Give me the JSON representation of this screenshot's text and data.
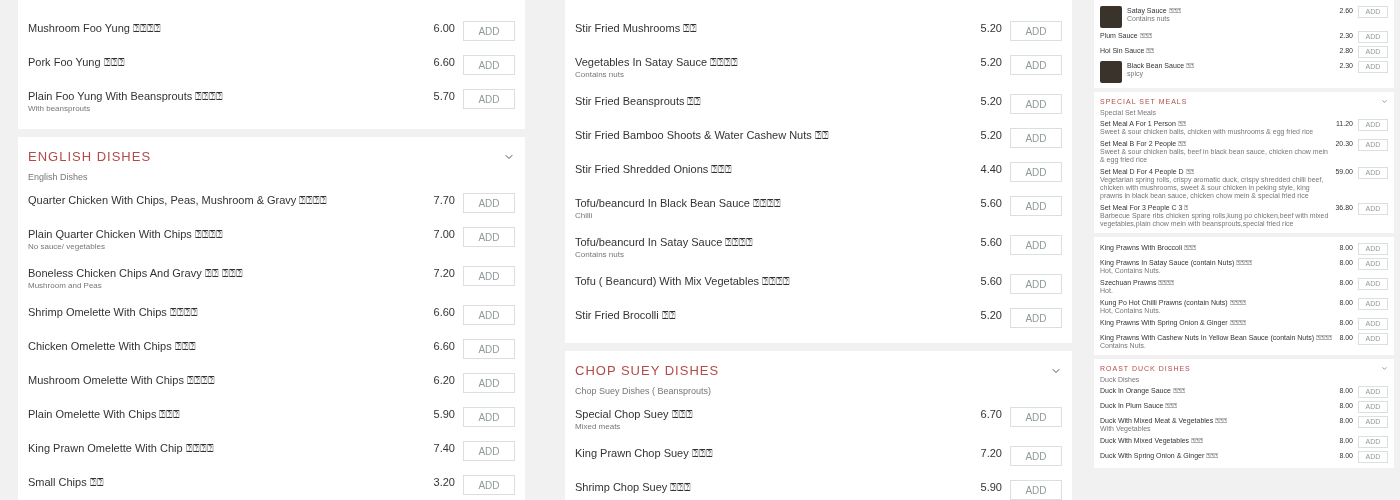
{
  "columns": [
    {
      "cards": [
        {
          "items": [
            {
              "name": "Mushroom Foo Yung ⍰⍰⍰⍰",
              "price": "6.00",
              "button": "ADD"
            },
            {
              "name": "Pork Foo Yung ⍰⍰⍰",
              "price": "6.60",
              "button": "ADD"
            },
            {
              "name": "Plain Foo Yung With Beansprouts ⍰⍰⍰⍰",
              "description": "With beansprouts",
              "price": "5.70",
              "button": "ADD"
            }
          ]
        },
        {
          "title": "ENGLISH DISHES",
          "subtitle": "English Dishes",
          "items": [
            {
              "name": "Quarter Chicken With Chips, Peas, Mushroom & Gravy ⍰⍰⍰⍰",
              "price": "7.70",
              "button": "ADD"
            },
            {
              "name": "Plain Quarter Chicken With Chips ⍰⍰⍰⍰",
              "description": "No sauce/ vegetables",
              "price": "7.00",
              "button": "ADD"
            },
            {
              "name": "Boneless Chicken Chips And Gravy ⍰⍰ ⍰⍰⍰",
              "description": "Mushroom and Peas",
              "price": "7.20",
              "button": "ADD"
            },
            {
              "name": "Shrimp Omelette With Chips ⍰⍰⍰⍰",
              "price": "6.60",
              "button": "ADD"
            },
            {
              "name": "Chicken Omelette With Chips ⍰⍰⍰",
              "price": "6.60",
              "button": "ADD"
            },
            {
              "name": "Mushroom Omelette With Chips ⍰⍰⍰⍰",
              "price": "6.20",
              "button": "ADD"
            },
            {
              "name": "Plain Omelette With Chips ⍰⍰⍰",
              "price": "5.90",
              "button": "ADD"
            },
            {
              "name": "King Prawn Omelette With Chip ⍰⍰⍰⍰",
              "price": "7.40",
              "button": "ADD"
            },
            {
              "name": "Small Chips ⍰⍰",
              "price": "3.20",
              "button": "ADD"
            }
          ]
        }
      ]
    },
    {
      "cards": [
        {
          "items": [
            {
              "name": "Stir Fried Mushrooms ⍰⍰",
              "price": "5.20",
              "button": "ADD"
            },
            {
              "name": "Vegetables In Satay Sauce ⍰⍰⍰⍰",
              "description": "Contains nuts",
              "price": "5.20",
              "button": "ADD"
            },
            {
              "name": "Stir Fried Beansprouts ⍰⍰",
              "price": "5.20",
              "button": "ADD"
            },
            {
              "name": "Stir Fried Bamboo Shoots & Water Cashew Nuts ⍰⍰",
              "price": "5.20",
              "button": "ADD"
            },
            {
              "name": "Stir Fried Shredded Onions ⍰⍰⍰",
              "price": "4.40",
              "button": "ADD"
            },
            {
              "name": "Tofu/beancurd In Black Bean Sauce ⍰⍰⍰⍰",
              "description": "Chilli",
              "price": "5.60",
              "button": "ADD"
            },
            {
              "name": "Tofu/beancurd In Satay Sauce ⍰⍰⍰⍰",
              "description": "Contains nuts",
              "price": "5.60",
              "button": "ADD"
            },
            {
              "name": "Tofu ( Beancurd) With Mix Vegetables ⍰⍰⍰⍰",
              "price": "5.60",
              "button": "ADD"
            },
            {
              "name": "Stir Fried Brocolli ⍰⍰",
              "price": "5.20",
              "button": "ADD"
            }
          ]
        },
        {
          "title": "CHOP SUEY DISHES",
          "subtitle": "Chop Suey Dishes ( Beansprouts)",
          "items": [
            {
              "name": "Special Chop Suey ⍰⍰⍰",
              "description": "Mixed meats",
              "price": "6.70",
              "button": "ADD"
            },
            {
              "name": "King Prawn Chop Suey ⍰⍰⍰",
              "price": "7.20",
              "button": "ADD"
            },
            {
              "name": "Shrimp Chop Suey ⍰⍰⍰",
              "price": "5.90",
              "button": "ADD"
            }
          ]
        }
      ]
    },
    {
      "cards": [
        {
          "items": [
            {
              "name": "Satay Sauce ⍰⍰⍰",
              "description": "Contains nuts",
              "price": "2.60",
              "button": "ADD",
              "photo": true
            },
            {
              "name": "Plum Sauce ⍰⍰⍰",
              "price": "2.30",
              "button": "ADD"
            },
            {
              "name": "Hoi Sin Sauce ⍰⍰",
              "price": "2.80",
              "button": "ADD"
            },
            {
              "name": "Black Bean Sauce ⍰⍰",
              "description": "spicy",
              "price": "2.30",
              "button": "ADD",
              "photo": true
            }
          ]
        },
        {
          "title": "SPECIAL SET MEALS",
          "subtitle": "Special Set Meals",
          "items": [
            {
              "name": "Set Meal A For 1 Person ⍰⍰",
              "description": "Sweet & sour chicken balls, chicken with mushrooms & egg fried rice",
              "price": "11.20",
              "button": "ADD"
            },
            {
              "name": "Set Meal B For 2 People ⍰⍰",
              "description": "Sweet & sour chicken balls, beef in black bean sauce, chicken chow mein & egg fried rice",
              "price": "20.30",
              "button": "ADD"
            },
            {
              "name": "Set Meal D For 4 People D ⍰⍰",
              "description": "Vegetarian spring rolls, crispy aromatic duck, crispy shredded chilli beef, chicken with mushrooms, sweet & sour chicken in peking style, king prawns in black bean sauce, chicken chow mein & special fried rice",
              "price": "59.00",
              "button": "ADD"
            },
            {
              "name": "Set Meal For 3 People C 3 ⍰",
              "description": "Barbecue Spare ribs chicken spring rolls,kung po chicken,beef with mixed vegetables,plain chow mein with beansprouts,special fried rice",
              "price": "36.80",
              "button": "ADD"
            }
          ]
        },
        {
          "items": [
            {
              "name": "King Prawns With Broccoli ⍰⍰⍰",
              "price": "8.00",
              "button": "ADD"
            },
            {
              "name": "King Prawns In Satay Sauce (contain Nuts) ⍰⍰⍰⍰",
              "description": "Hot, Contains Nuts.",
              "price": "8.00",
              "button": "ADD"
            },
            {
              "name": "Szechuan Prawns ⍰⍰⍰⍰",
              "description": "Hot.",
              "price": "8.00",
              "button": "ADD"
            },
            {
              "name": "Kung Po Hot Chilli Prawns (contain Nuts) ⍰⍰⍰⍰",
              "description": "Hot, Contains Nuts.",
              "price": "8.00",
              "button": "ADD"
            },
            {
              "name": "King Prawns With Spring Onion & Ginger ⍰⍰⍰⍰",
              "price": "8.00",
              "button": "ADD"
            },
            {
              "name": "King Prawns With Cashew Nuts In Yellow Bean Sauce (contain Nuts) ⍰⍰⍰⍰",
              "description": "Contains Nuts.",
              "price": "8.00",
              "button": "ADD"
            }
          ]
        },
        {
          "title": "ROAST DUCK DISHES",
          "subtitle": "Duck Dishes",
          "items": [
            {
              "name": "Duck In Orange Sauce ⍰⍰⍰",
              "price": "8.00",
              "button": "ADD"
            },
            {
              "name": "Duck In Plum Sauce ⍰⍰⍰",
              "price": "8.00",
              "button": "ADD"
            },
            {
              "name": "Duck With Mixed Meat & Vegetables ⍰⍰⍰",
              "description": "With Vegetables",
              "price": "8.00",
              "button": "ADD"
            },
            {
              "name": "Duck With Mixed Vegetables ⍰⍰⍰",
              "price": "8.00",
              "button": "ADD"
            },
            {
              "name": "Duck With Spring Onion & Ginger ⍰⍰⍰",
              "price": "8.00",
              "button": "ADD"
            }
          ]
        }
      ]
    }
  ]
}
